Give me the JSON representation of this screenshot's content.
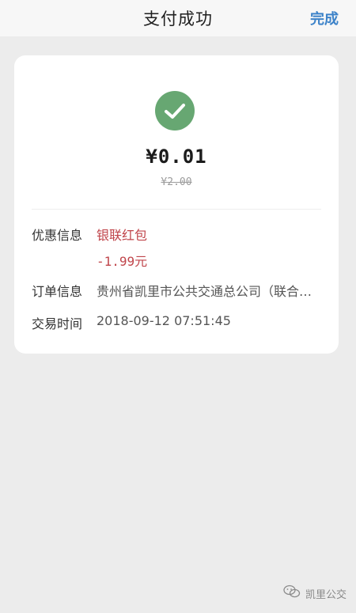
{
  "header": {
    "title": "支付成功",
    "done_label": "完成"
  },
  "receipt": {
    "amount": "¥0.01",
    "original_amount": "¥2.00",
    "discount": {
      "label": "优惠信息",
      "name": "银联红包",
      "value": "-1.99元"
    },
    "order": {
      "label": "订单信息",
      "value": "贵州省凯里市公共交通总公司（联合一卡通）"
    },
    "time": {
      "label": "交易时间",
      "value": "2018-09-12 07:51:45"
    }
  },
  "watermark": {
    "icon": "wechat-icon",
    "text": "凯里公交"
  },
  "colors": {
    "accent": "#3d83c9",
    "success": "#67a772",
    "discount": "#c0454b",
    "background": "#ececec"
  }
}
